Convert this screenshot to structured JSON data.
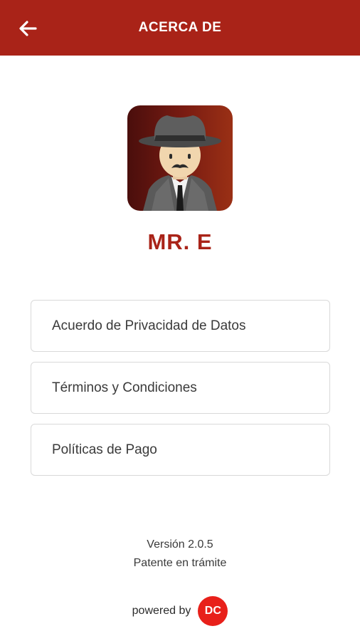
{
  "header": {
    "title": "ACERCA DE",
    "back_icon": "arrow-left-icon",
    "background_color": "#a92318"
  },
  "app": {
    "name": "MR. E",
    "logo_icon": "detective-avatar-icon",
    "accent_color": "#a92318"
  },
  "menu": {
    "items": [
      {
        "label": "Acuerdo de Privacidad de Datos"
      },
      {
        "label": "Términos y Condiciones"
      },
      {
        "label": "Políticas de Pago"
      }
    ]
  },
  "footer": {
    "version": "Versión 2.0.5",
    "patent": "Patente en trámite",
    "powered_by": "powered by",
    "brand_badge": "DC",
    "brand_color": "#e8201a"
  }
}
